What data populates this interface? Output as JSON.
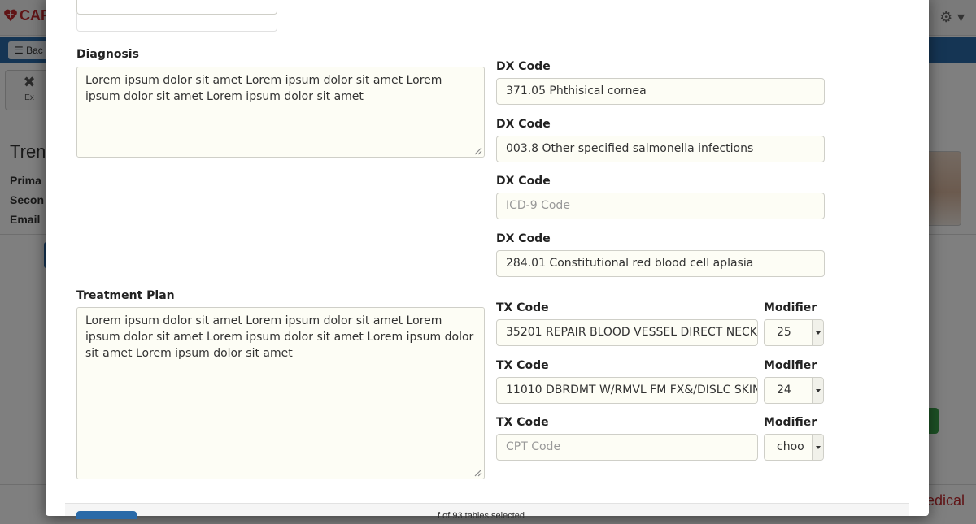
{
  "background": {
    "logo_text": "CAR",
    "back_label": "Bac",
    "exit_label": "Ex",
    "patient_name": "Tren",
    "field_labels": [
      "Prima",
      "Secon",
      "Email"
    ],
    "brand_text": "edical",
    "status_text": "f of 93 tables selected"
  },
  "diagnosis": {
    "label": "Diagnosis",
    "text": "Lorem ipsum dolor sit amet Lorem ipsum dolor sit amet Lorem ipsum dolor sit amet Lorem ipsum dolor sit amet"
  },
  "dx_codes": [
    {
      "label": "DX Code",
      "value": "371.05 Phthisical cornea",
      "placeholder": "ICD-9 Code"
    },
    {
      "label": "DX Code",
      "value": "003.8 Other specified salmonella infections",
      "placeholder": "ICD-9 Code"
    },
    {
      "label": "DX Code",
      "value": "",
      "placeholder": "ICD-9 Code"
    },
    {
      "label": "DX Code",
      "value": "284.01 Constitutional red blood cell aplasia",
      "placeholder": "ICD-9 Code"
    }
  ],
  "treatment": {
    "label": "Treatment Plan",
    "text": "Lorem ipsum dolor sit amet Lorem ipsum dolor sit amet Lorem ipsum dolor sit amet Lorem ipsum dolor sit amet Lorem ipsum dolor sit amet Lorem ipsum dolor sit amet"
  },
  "tx_codes": [
    {
      "label": "TX Code",
      "value": "35201 REPAIR BLOOD VESSEL DIRECT NECK",
      "placeholder": "CPT Code",
      "modifier_label": "Modifier",
      "modifier": "25"
    },
    {
      "label": "TX Code",
      "value": "11010 DBRDMT W/RMVL FM FX&/DISLC SKIN",
      "placeholder": "CPT Code",
      "modifier_label": "Modifier",
      "modifier": "24"
    },
    {
      "label": "TX Code",
      "value": "",
      "placeholder": "CPT Code",
      "modifier_label": "Modifier",
      "modifier": "choo"
    }
  ]
}
